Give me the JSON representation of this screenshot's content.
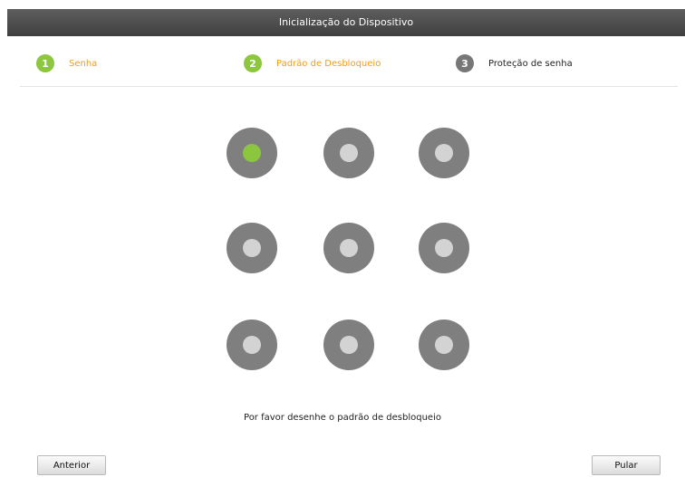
{
  "window": {
    "title": "Inicialização do Dispositivo"
  },
  "steps": [
    {
      "number": "1",
      "label": "Senha",
      "state": "done",
      "color": "#8dc63f",
      "label_color": "#f39c12"
    },
    {
      "number": "2",
      "label": "Padrão de Desbloqueio",
      "state": "active",
      "color": "#8dc63f",
      "label_color": "#f39c12"
    },
    {
      "number": "3",
      "label": "Proteção de senha",
      "state": "pending",
      "color": "#777777",
      "label_color": "#222222"
    }
  ],
  "pattern": {
    "dots": [
      {
        "selected": true
      },
      {
        "selected": false
      },
      {
        "selected": false
      },
      {
        "selected": false
      },
      {
        "selected": false
      },
      {
        "selected": false
      },
      {
        "selected": false
      },
      {
        "selected": false
      },
      {
        "selected": false
      }
    ],
    "colors": {
      "ring": "#7f7f7f",
      "core": "#d3d3d3",
      "selected_core": "#8cc63f"
    }
  },
  "instruction": "Por favor desenhe o padrão de desbloqueio",
  "buttons": {
    "previous_label": "Anterior",
    "skip_label": "Pular"
  }
}
